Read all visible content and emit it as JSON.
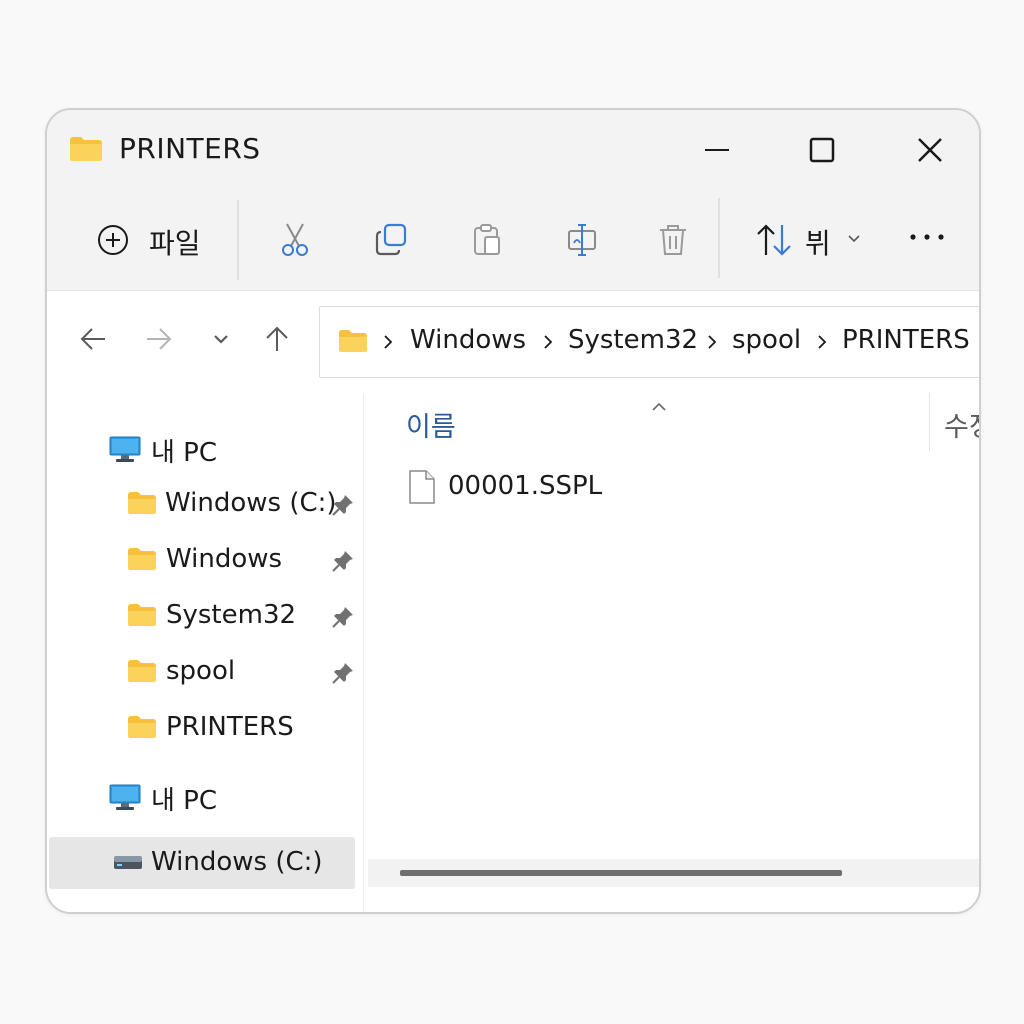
{
  "window": {
    "title": "PRINTERS"
  },
  "command_bar": {
    "new_label": "파일",
    "sort_label": "뷔",
    "tools": [
      "cut-icon",
      "copy-icon",
      "paste-icon",
      "rename-icon",
      "delete-icon"
    ]
  },
  "address_bar": {
    "crumbs": [
      "Windows",
      "System32",
      "spool",
      "PRINTERS"
    ]
  },
  "sidebar": {
    "items": [
      {
        "label": "내 PC",
        "icon": "pc-icon"
      },
      {
        "label": "Windows (C:)",
        "icon": "folder-icon",
        "pinned": true
      },
      {
        "label": "Windows",
        "icon": "folder-icon",
        "pinned": true
      },
      {
        "label": "System32",
        "icon": "folder-icon",
        "pinned": true
      },
      {
        "label": "spool",
        "icon": "folder-icon",
        "pinned": true
      },
      {
        "label": "PRINTERS",
        "icon": "folder-icon",
        "pinned": false
      },
      {
        "label": "내 PC",
        "icon": "pc-icon"
      },
      {
        "label": "Windows (C:)",
        "icon": "drive-icon",
        "selected": true
      }
    ]
  },
  "content": {
    "columns": {
      "name": "이름",
      "date": "수정"
    },
    "files": [
      {
        "name": "00001.SSPL",
        "icon": "file-icon"
      }
    ]
  },
  "colors": {
    "folder": "#f6c23e",
    "accent": "#2a5a9a",
    "chrome": "#f3f3f3"
  }
}
